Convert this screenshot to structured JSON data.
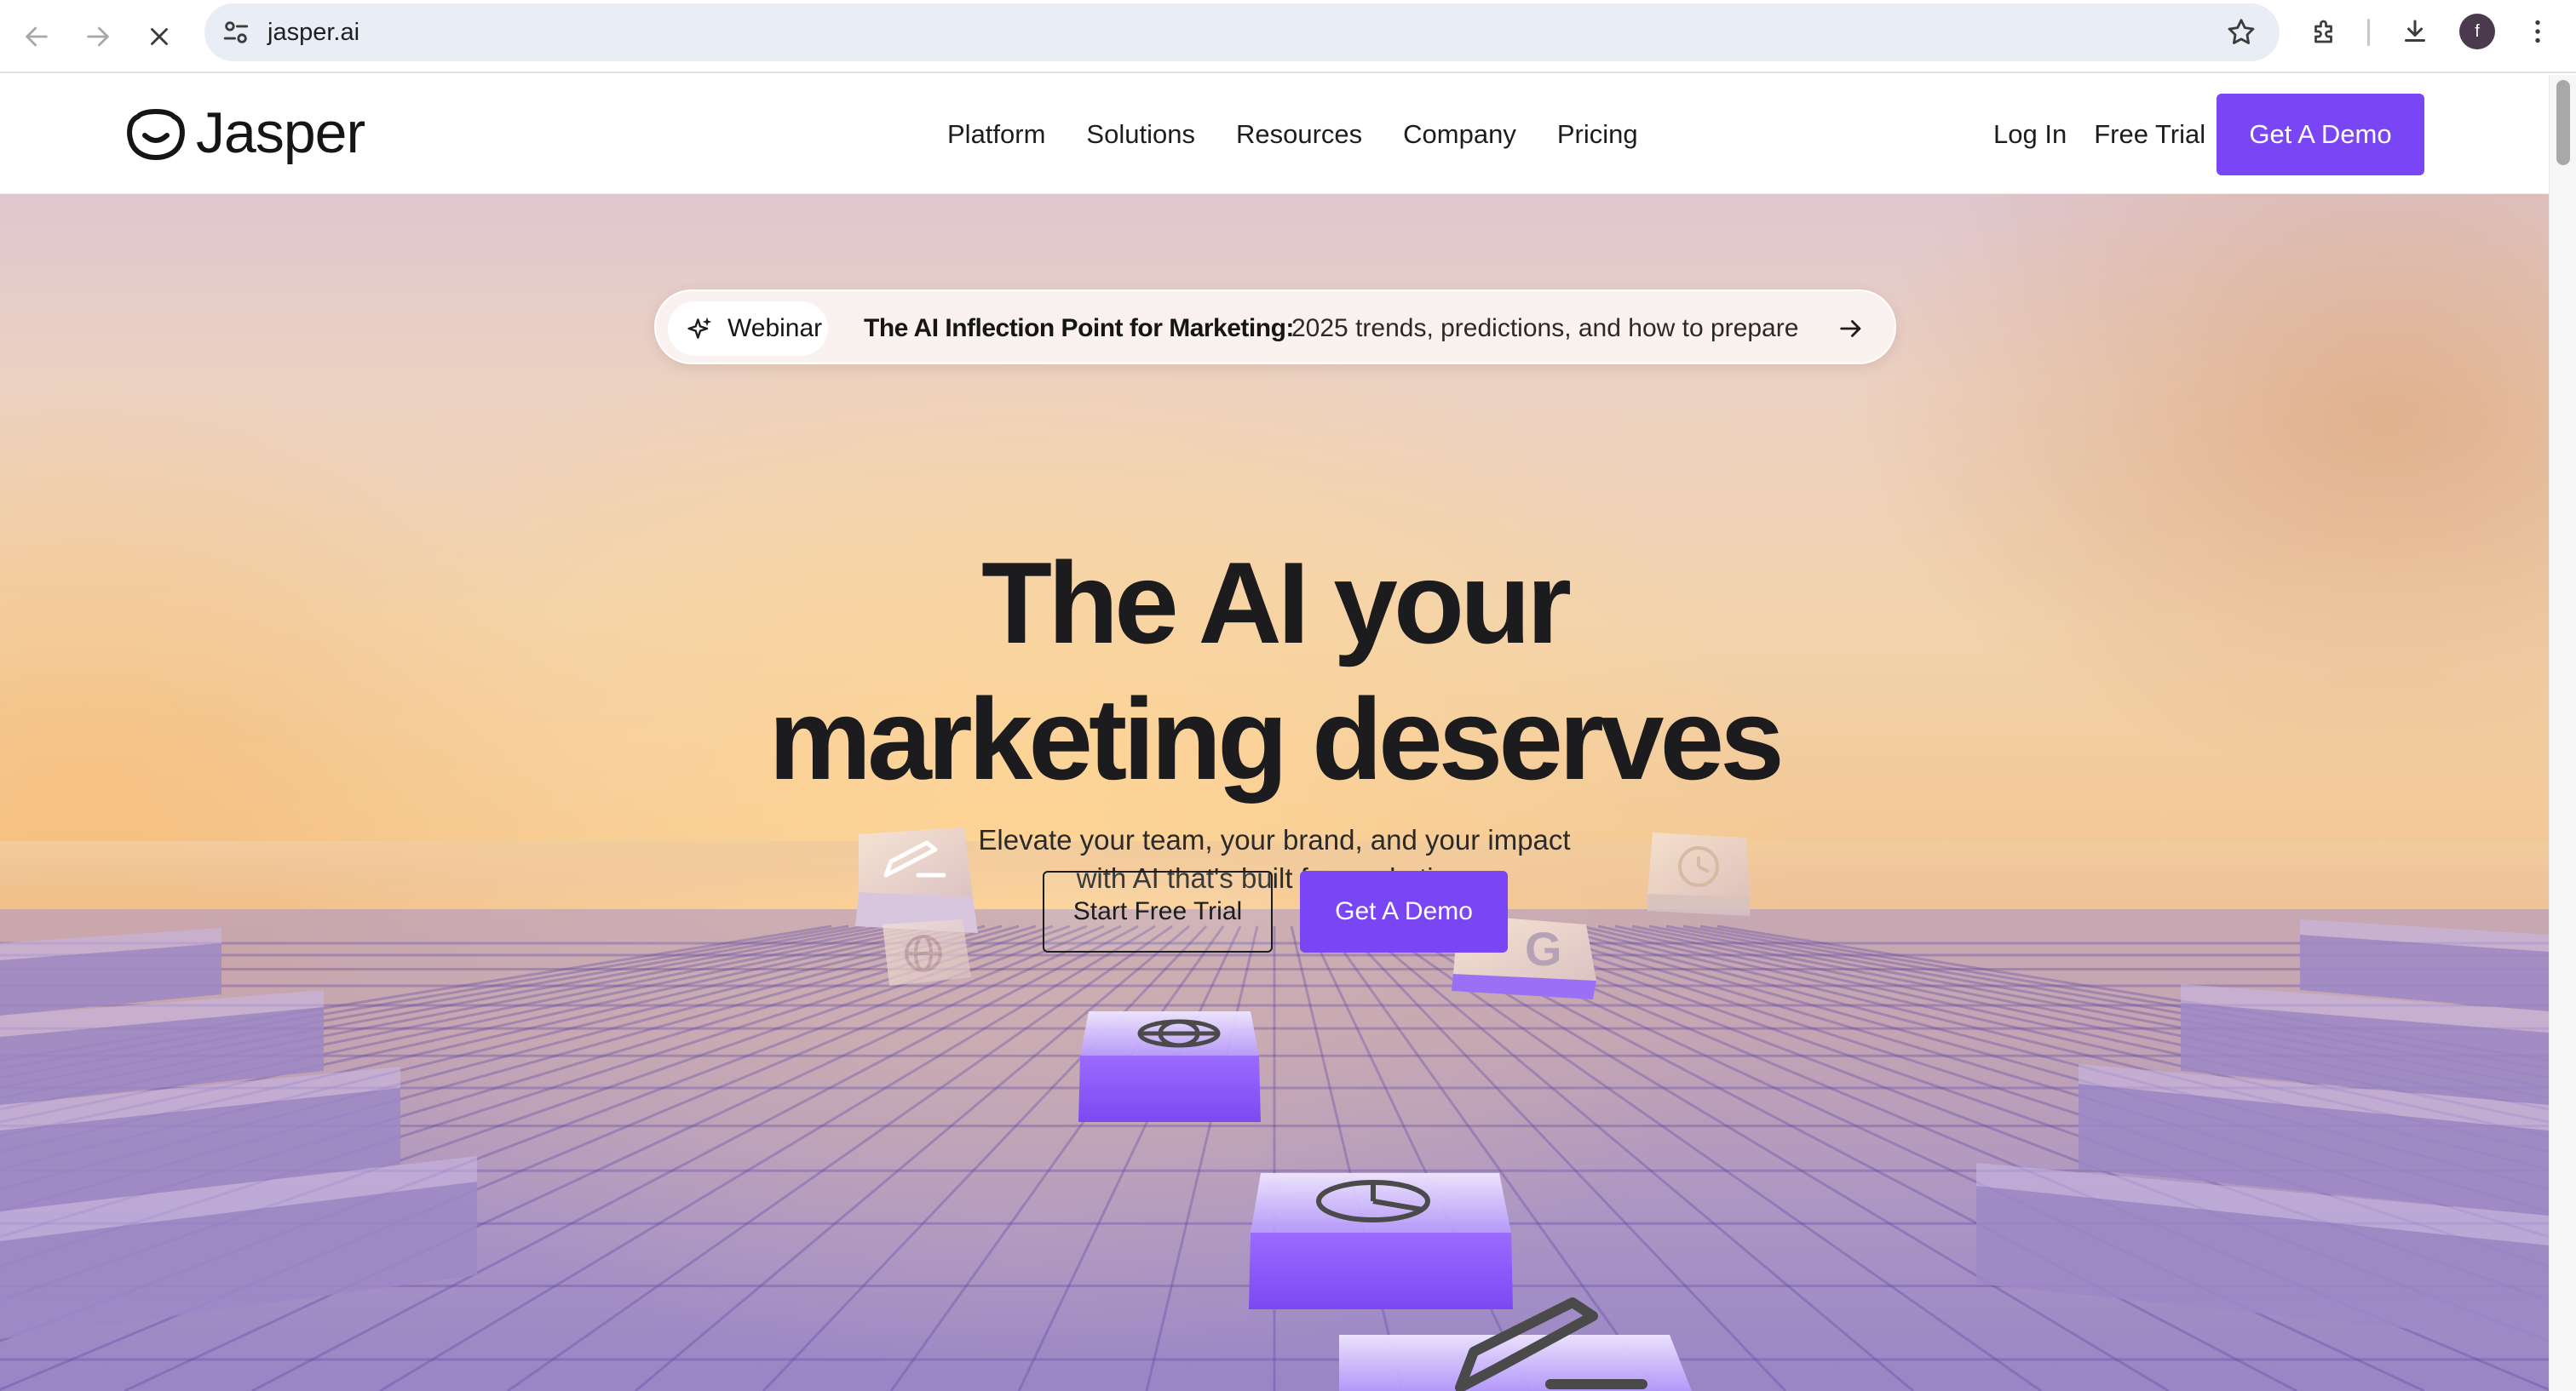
{
  "browser": {
    "url": "jasper.ai",
    "profile_initial": "f"
  },
  "header": {
    "logo_text": "Jasper",
    "nav": [
      {
        "label": "Platform"
      },
      {
        "label": "Solutions"
      },
      {
        "label": "Resources"
      },
      {
        "label": "Company"
      },
      {
        "label": "Pricing"
      }
    ],
    "login_label": "Log In",
    "free_trial_label": "Free Trial",
    "demo_label": "Get A Demo"
  },
  "hero": {
    "webinar_label": "Webinar",
    "webinar_title": "The AI Inflection Point for Marketing:",
    "webinar_desc": "2025 trends, predictions, and how to prepare",
    "headline_line1": "The AI your",
    "headline_line2": "marketing deserves",
    "subhead_line1": "Elevate your team, your brand, and your impact",
    "subhead_line2": "with AI that's built for marketing.",
    "cta_trial": "Start Free Trial",
    "cta_demo": "Get A Demo"
  },
  "colors": {
    "accent": "#7a45f5",
    "text": "#1c1b1d",
    "omnibox": "#e9eef6"
  },
  "icons": [
    "back-arrow-icon",
    "forward-arrow-icon",
    "stop-loading-icon",
    "site-settings-icon",
    "bookmark-star-icon",
    "extensions-icon",
    "download-icon",
    "more-vert-icon",
    "sparkle-icon",
    "arrow-right-icon",
    "pencil-icon",
    "globe-icon",
    "pie-chart-icon",
    "g-letter-icon"
  ]
}
